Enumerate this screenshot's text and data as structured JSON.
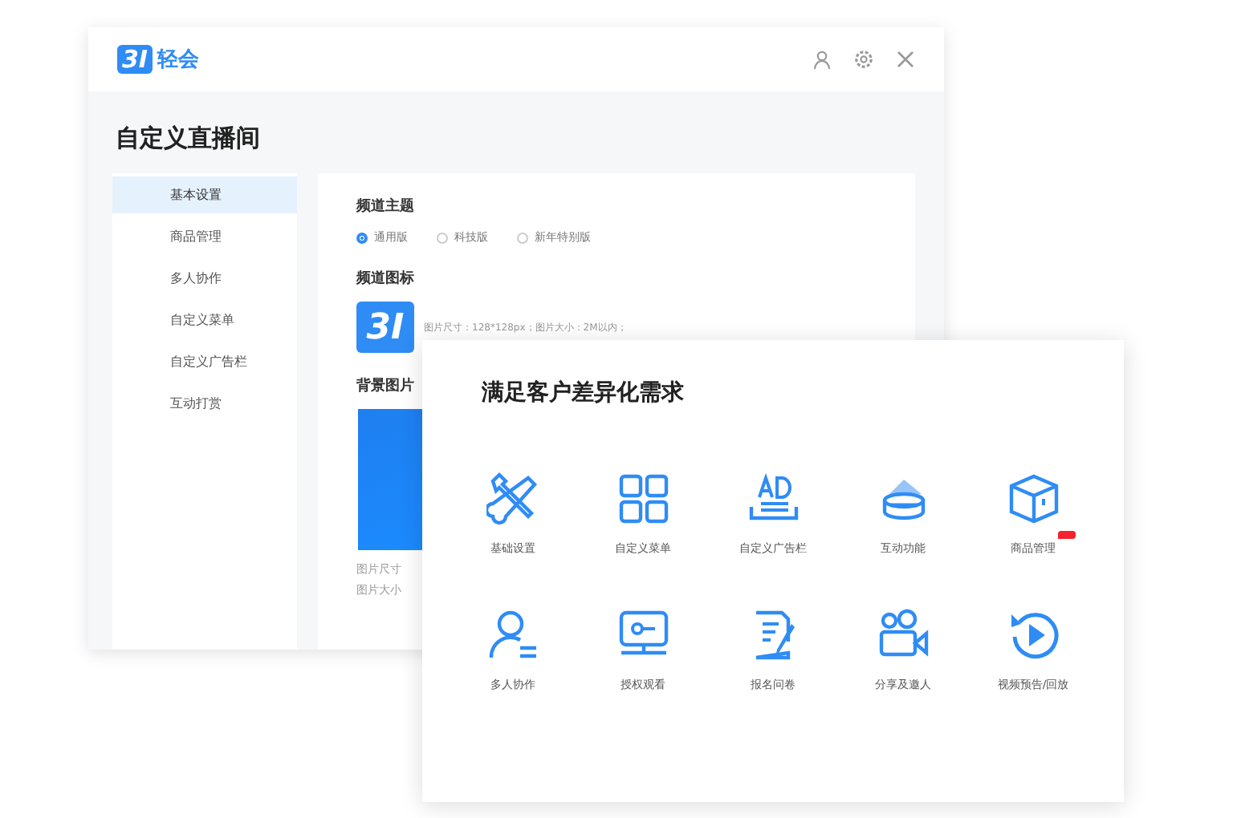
{
  "window": {
    "logo_mark": "3I",
    "logo_text": "轻会",
    "title": "自定义直播间"
  },
  "sidebar": {
    "items": [
      {
        "label": "基本设置",
        "selected": true
      },
      {
        "label": "商品管理",
        "selected": false
      },
      {
        "label": "多人协作",
        "selected": false
      },
      {
        "label": "自定义菜单",
        "selected": false
      },
      {
        "label": "自定义广告栏",
        "selected": false
      },
      {
        "label": "互动打赏",
        "selected": false
      }
    ]
  },
  "settings": {
    "theme_heading": "频道主题",
    "themes": [
      {
        "label": "通用版",
        "selected": true
      },
      {
        "label": "科技版",
        "selected": false
      },
      {
        "label": "新年特别版",
        "selected": false
      }
    ],
    "icon_heading": "频道图标",
    "icon_mark": "3I",
    "icon_hint": "图片尺寸：128*128px；图片大小：2M以内；",
    "background_heading": "背景图片",
    "background_hints": [
      "图片尺寸",
      "图片大小"
    ]
  },
  "feature_card": {
    "title": "满足客户差异化需求",
    "features": [
      {
        "kind": "tools",
        "label": "基础设置",
        "badge": false
      },
      {
        "kind": "grid",
        "label": "自定义菜单",
        "badge": false
      },
      {
        "kind": "ad",
        "label": "自定义广告栏",
        "badge": false
      },
      {
        "kind": "gift",
        "label": "互动功能",
        "badge": false
      },
      {
        "kind": "box",
        "label": "商品管理",
        "badge": true
      },
      {
        "kind": "person",
        "label": "多人协作",
        "badge": false
      },
      {
        "kind": "monitor",
        "label": "授权观看",
        "badge": false
      },
      {
        "kind": "form",
        "label": "报名问卷",
        "badge": false
      },
      {
        "kind": "camera",
        "label": "分享及邀人",
        "badge": false
      },
      {
        "kind": "replay",
        "label": "视频预告/回放",
        "badge": false
      }
    ]
  }
}
